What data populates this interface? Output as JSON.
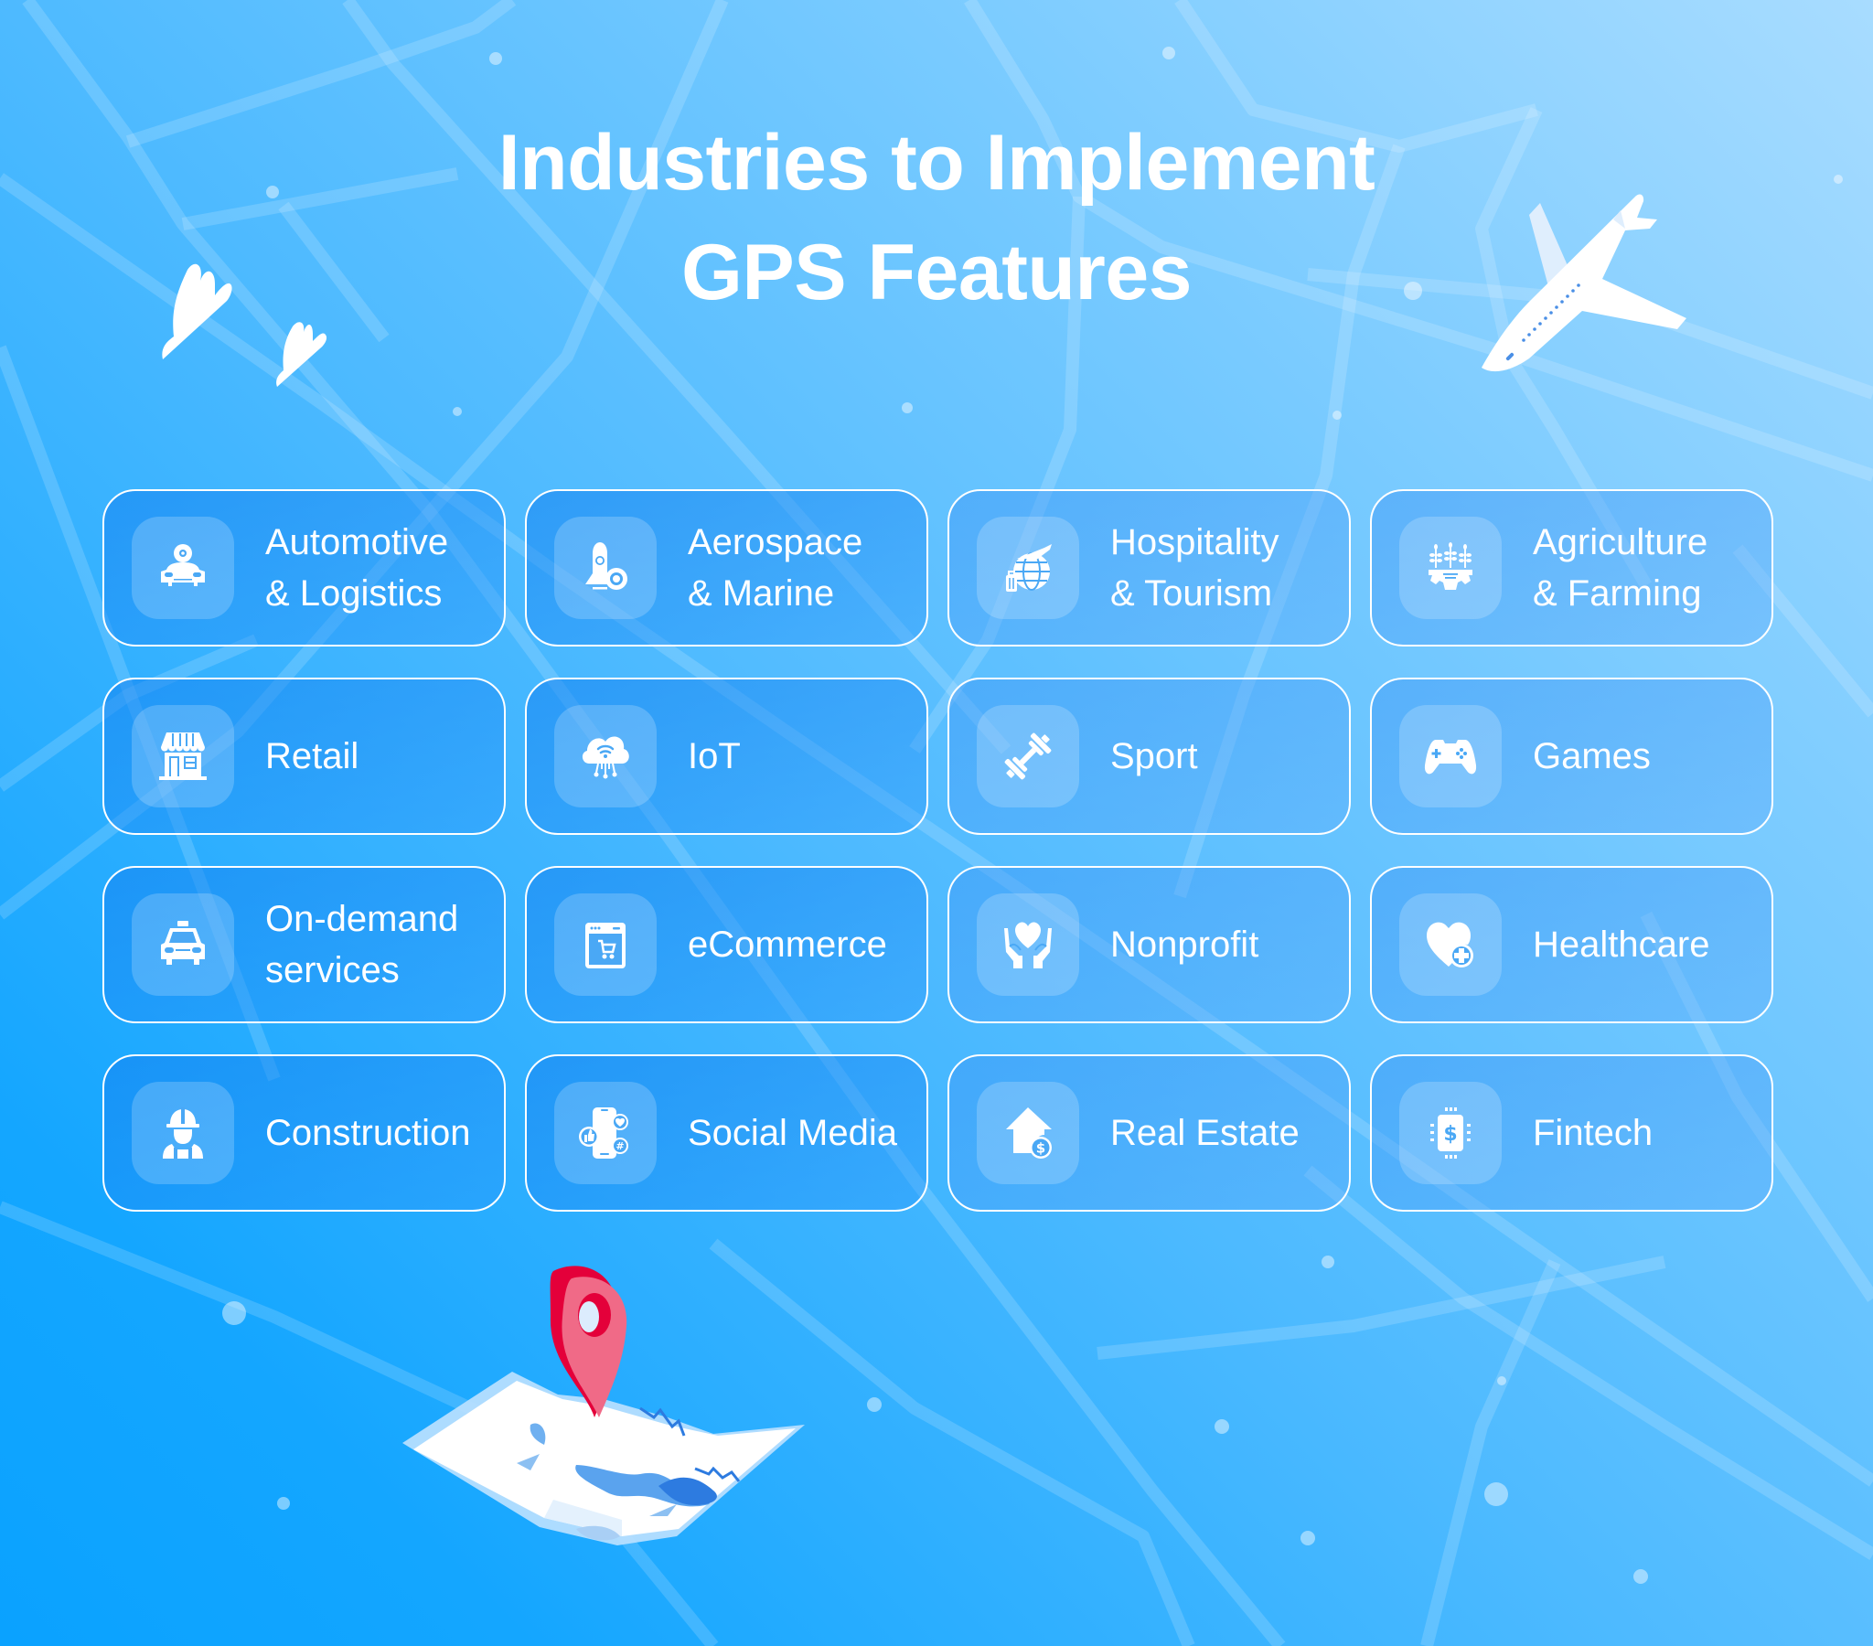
{
  "title": {
    "line1": "Industries to Implement",
    "line2": "GPS Features"
  },
  "industries": [
    {
      "line1": "Automotive",
      "line2": "& Logistics",
      "icon": "car-gear-icon"
    },
    {
      "line1": "Aerospace",
      "line2": "& Marine",
      "icon": "rocket-gear-icon"
    },
    {
      "line1": "Hospitality",
      "line2": "& Tourism",
      "icon": "globe-plane-luggage-icon"
    },
    {
      "line1": "Agriculture",
      "line2": "& Farming",
      "icon": "plants-gear-icon"
    },
    {
      "line1": "Retail",
      "line2": "",
      "icon": "storefront-icon"
    },
    {
      "line1": "IoT",
      "line2": "",
      "icon": "cloud-wifi-icon"
    },
    {
      "line1": "Sport",
      "line2": "",
      "icon": "dumbbell-icon"
    },
    {
      "line1": "Games",
      "line2": "",
      "icon": "gamepad-icon"
    },
    {
      "line1": "On-demand",
      "line2": "services",
      "icon": "taxi-icon"
    },
    {
      "line1": "eCommerce",
      "line2": "",
      "icon": "browser-cart-icon"
    },
    {
      "line1": "Nonprofit",
      "line2": "",
      "icon": "hands-heart-icon"
    },
    {
      "line1": "Healthcare",
      "line2": "",
      "icon": "heart-medical-icon"
    },
    {
      "line1": "Construction",
      "line2": "",
      "icon": "worker-helmet-icon"
    },
    {
      "line1": "Social Media",
      "line2": "",
      "icon": "phone-social-icon"
    },
    {
      "line1": "Real Estate",
      "line2": "",
      "icon": "house-dollar-icon"
    },
    {
      "line1": "Fintech",
      "line2": "",
      "icon": "chip-dollar-icon"
    }
  ],
  "colors": {
    "background_start": "#0aa2ff",
    "background_end": "#a8dcff",
    "pin_red": "#e4003a",
    "pin_pink": "#f06a87",
    "card_border": "#ffffff",
    "text": "#ffffff"
  }
}
